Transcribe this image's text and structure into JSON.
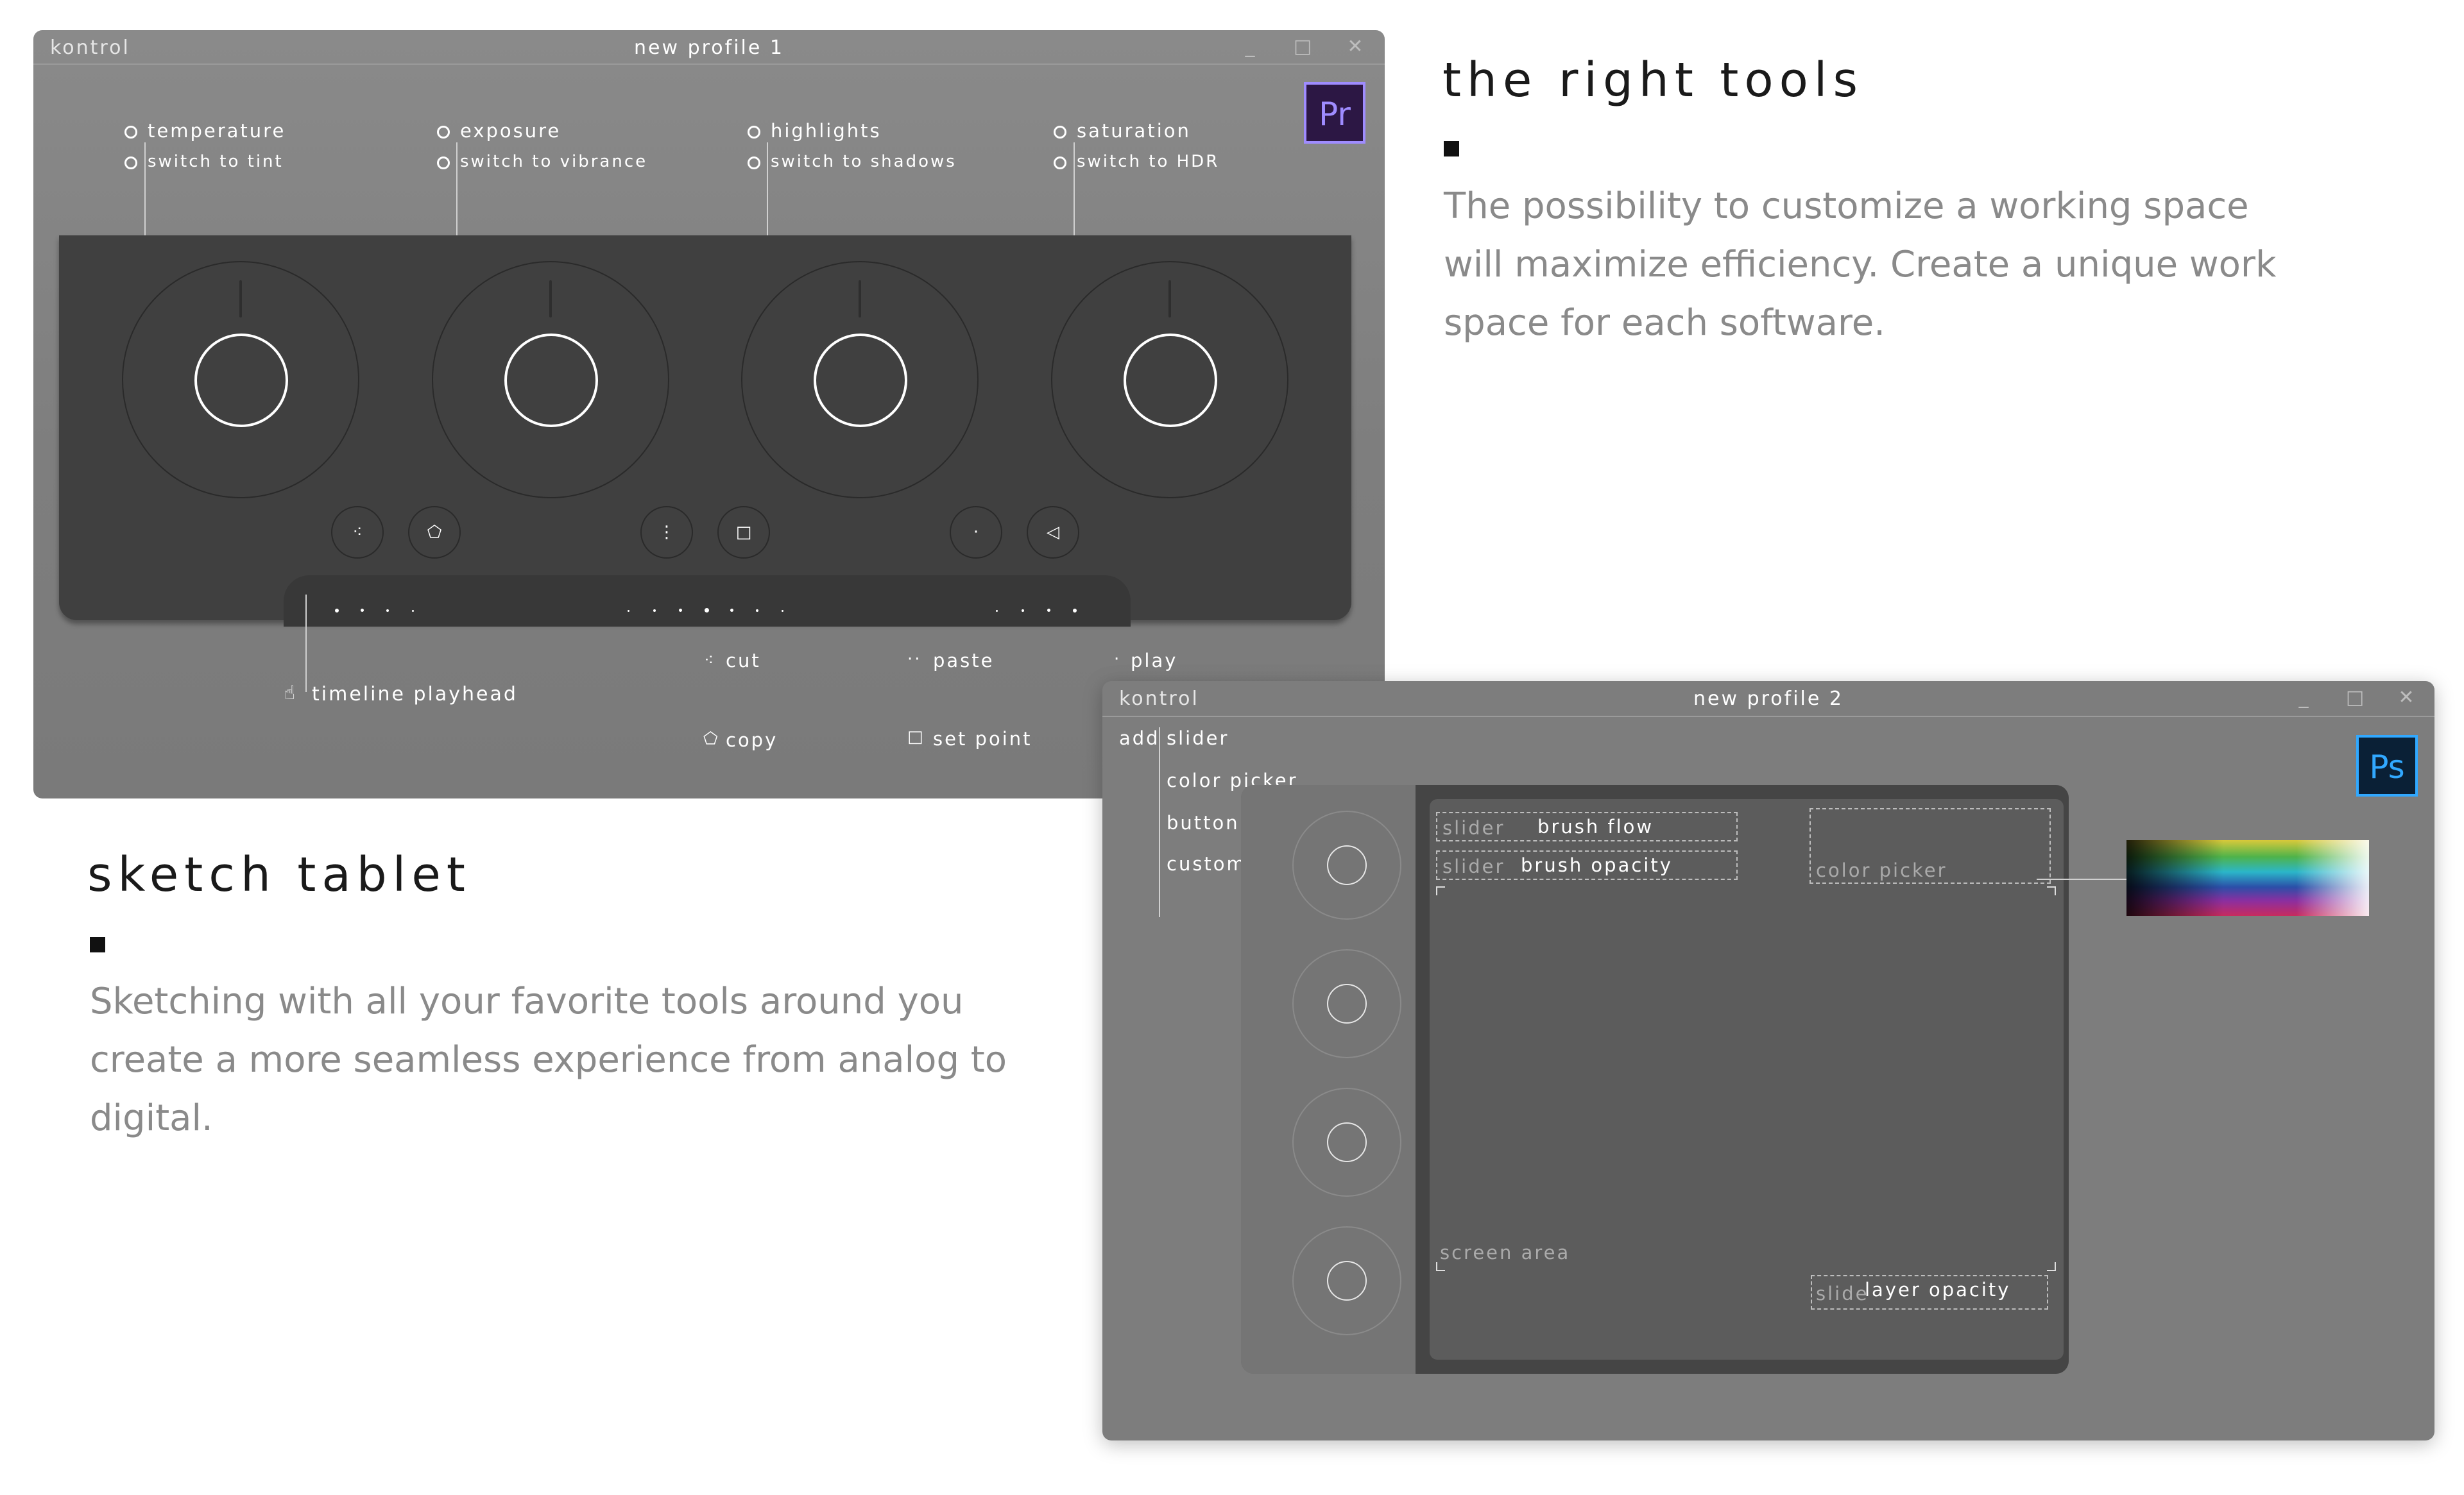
{
  "window1": {
    "app_name": "kontrol",
    "title": "new profile 1",
    "controls": [
      "_",
      "□",
      "✕"
    ],
    "app_badge": {
      "text": "Pr",
      "color": "#9f8cff",
      "bg": "#2c1744"
    },
    "knobs": [
      {
        "primary": "temperature",
        "secondary": "switch to tint"
      },
      {
        "primary": "exposure",
        "secondary": "switch to vibrance"
      },
      {
        "primary": "highlights",
        "secondary": "switch to shadows"
      },
      {
        "primary": "saturation",
        "secondary": "switch to HDR"
      }
    ],
    "shortcuts": {
      "cut": "cut",
      "paste": "paste",
      "play": "play",
      "copy": "copy",
      "set_point": "set point"
    },
    "timeline_label": "timeline playhead"
  },
  "right_tools": {
    "heading": "the right tools",
    "body": "The possibility to customize a working space will maximize efficiency. Create a unique work space for each software."
  },
  "sketch_tablet": {
    "heading": "sketch tablet",
    "body": "Sketching with all your favorite tools around you create a more seamless experience from analog to digital."
  },
  "window2": {
    "app_name": "kontrol",
    "title": "new profile 2",
    "controls": [
      "_",
      "□",
      "✕"
    ],
    "app_badge": {
      "text": "Ps",
      "color": "#31a8ff",
      "bg": "#0a2036"
    },
    "add_menu": {
      "add_label": "add",
      "items": [
        "slider",
        "color picker",
        "button",
        "custom"
      ]
    },
    "widgets": {
      "brush_flow": {
        "type": "slider",
        "label": "brush flow"
      },
      "brush_opacity": {
        "type": "slider",
        "label": "brush opacity"
      },
      "color_picker": "color picker",
      "screen_area": "screen area",
      "layer_opacity": {
        "type": "slide",
        "label": "layer opacity"
      }
    }
  }
}
